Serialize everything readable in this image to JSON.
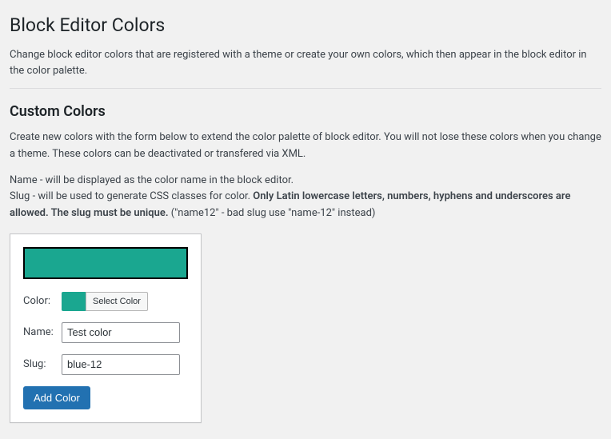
{
  "page": {
    "title": "Block Editor Colors",
    "intro": "Change block editor colors that are registered with a theme or create your own colors, which then appear in the block editor in the color palette."
  },
  "custom": {
    "heading": "Custom Colors",
    "desc": "Create new colors with the form below to extend the color palette of block editor. You will not lose these colors when you change a theme. These colors can be deactivated or transfered via XML.",
    "help_name": "Name - will be displayed as the color name in the block editor.",
    "help_slug_prefix": "Slug - will be used to generate CSS classes for color. ",
    "help_slug_bold": "Only Latin lowercase letters, numbers, hyphens and underscores are allowed. The slug must be unique.",
    "help_slug_suffix": " (\"name12\" - bad slug use \"name-12\" instead)"
  },
  "form": {
    "swatch_color": "#1aa790",
    "color_label": "Color:",
    "select_color_btn": "Select Color",
    "name_label": "Name:",
    "name_value": "Test color",
    "slug_label": "Slug:",
    "slug_value": "blue-12",
    "submit_label": "Add Color"
  }
}
